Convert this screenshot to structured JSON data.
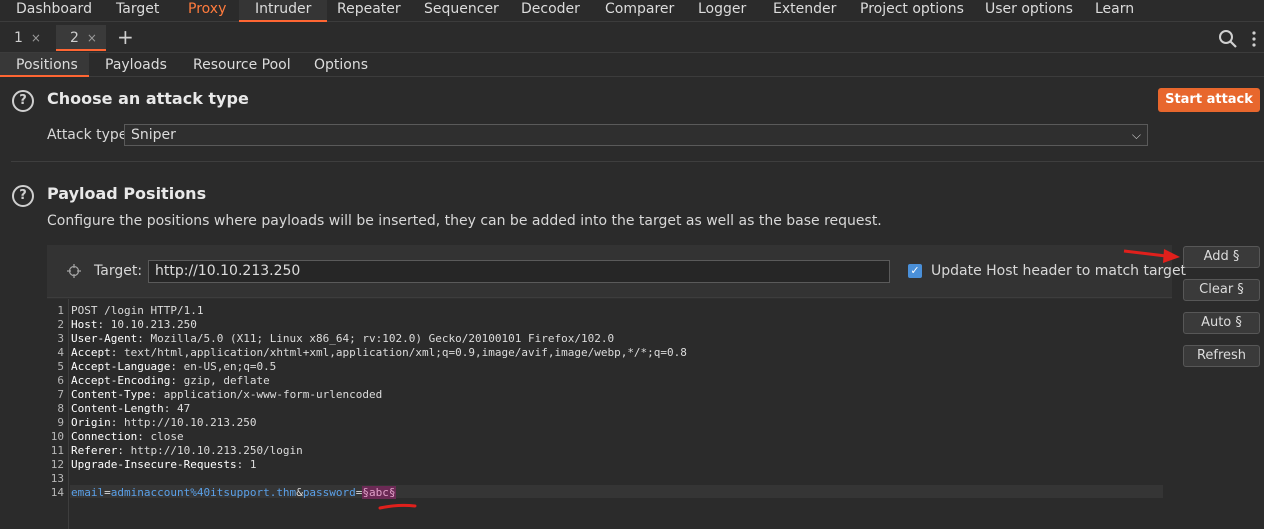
{
  "topnav": {
    "items": [
      "Dashboard",
      "Target",
      "Proxy",
      "Intruder",
      "Repeater",
      "Sequencer",
      "Decoder",
      "Comparer",
      "Logger",
      "Extender",
      "Project options",
      "User options",
      "Learn"
    ]
  },
  "tabs": [
    {
      "label": "1",
      "close": "×"
    },
    {
      "label": "2",
      "close": "×"
    }
  ],
  "new_tab": "+",
  "subtabs": [
    "Positions",
    "Payloads",
    "Resource Pool",
    "Options"
  ],
  "attack_section": {
    "help": "?",
    "title": "Choose an attack type",
    "start_button": "Start attack",
    "type_label": "Attack type:",
    "type_value": "Sniper",
    "chevron": "⌵"
  },
  "payload_section": {
    "help": "?",
    "title": "Payload Positions",
    "description": "Configure the positions where payloads will be inserted, they can be added into the target as well as the base request.",
    "target_label": "Target:",
    "target_value": "http://10.10.213.250",
    "update_host_checked": true,
    "update_host_label": "Update Host header to match target",
    "buttons": {
      "add": "Add §",
      "clear": "Clear §",
      "auto": "Auto §",
      "refresh": "Refresh"
    }
  },
  "request": {
    "line_numbers": [
      "1",
      "2",
      "3",
      "4",
      "5",
      "6",
      "7",
      "8",
      "9",
      "10",
      "11",
      "12",
      "13",
      "14"
    ],
    "first_line": "POST /login HTTP/1.1",
    "headers": [
      {
        "name": "Host",
        "value": "10.10.213.250"
      },
      {
        "name": "User-Agent",
        "value": "Mozilla/5.0 (X11; Linux x86_64; rv:102.0) Gecko/20100101 Firefox/102.0"
      },
      {
        "name": "Accept",
        "value": "text/html,application/xhtml+xml,application/xml;q=0.9,image/avif,image/webp,*/*;q=0.8"
      },
      {
        "name": "Accept-Language",
        "value": "en-US,en;q=0.5"
      },
      {
        "name": "Accept-Encoding",
        "value": "gzip, deflate"
      },
      {
        "name": "Content-Type",
        "value": "application/x-www-form-urlencoded"
      },
      {
        "name": "Content-Length",
        "value": "47"
      },
      {
        "name": "Origin",
        "value": "http://10.10.213.250"
      },
      {
        "name": "Connection",
        "value": "close"
      },
      {
        "name": "Referer",
        "value": "http://10.10.213.250/login"
      },
      {
        "name": "Upgrade-Insecure-Requests",
        "value": "1"
      }
    ],
    "body": {
      "email_key": "email",
      "email_value": "adminaccount%40itsupport.thm",
      "password_key": "password",
      "password_marked": "§abc§"
    }
  },
  "colors": {
    "accent": "#ff6633",
    "start_button": "#e8672d",
    "annotation": "#e0201c",
    "payload_marker": "#6b2a55"
  }
}
